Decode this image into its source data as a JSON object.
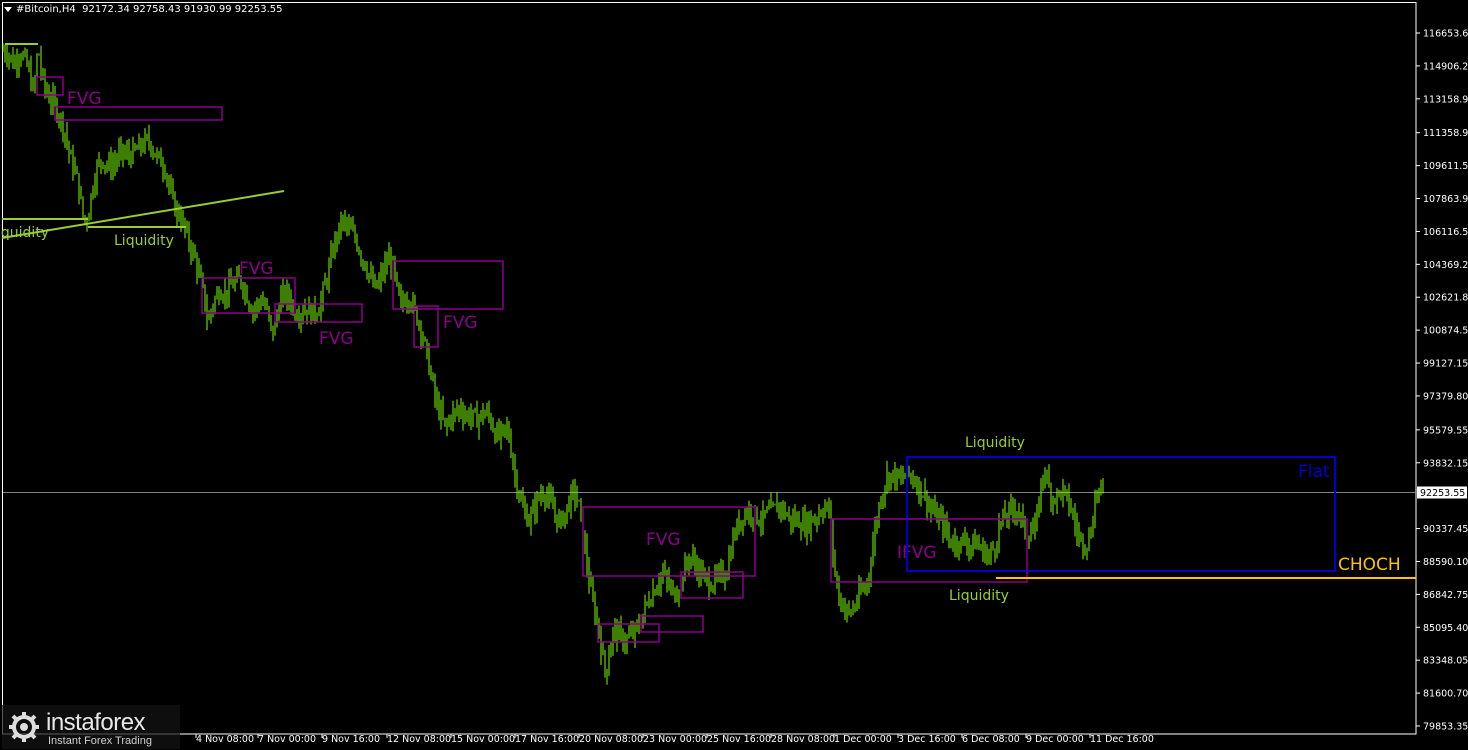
{
  "header": {
    "symbol": "#Bitcoin,H4",
    "ohlc": "92172.34 92758.43 91930.99 92253.55"
  },
  "branding": {
    "name": "instaforex",
    "tagline": "Instant Forex Trading",
    "icon": "instaforex-gear-icon"
  },
  "colors": {
    "background": "#000000",
    "candle": "#7CFC00",
    "fvg": "#8B008B",
    "liquidity": "#9ACD32",
    "flat": "#0000CD",
    "choch": "#FFC400",
    "grid_text": "#FFFFFF"
  },
  "chart_data": {
    "type": "candlestick",
    "symbol": "#Bitcoin",
    "timeframe": "H4",
    "last_price": "92253.55",
    "ylim": [
      79853.35,
      118000
    ],
    "price_ticks": [
      "116653.60",
      "114906.25",
      "113158.90",
      "111358.90",
      "109611.55",
      "107863.90",
      "106116.55",
      "104369.20",
      "102621.85",
      "100874.50",
      "99127.15",
      "97379.80",
      "95579.55",
      "93832.15",
      "92253.55",
      "90337.45",
      "88590.10",
      "86842.75",
      "85095.40",
      "83348.05",
      "81600.70",
      "79853.35"
    ],
    "time_labels": [
      "4 Nov 08:00",
      "7 Nov 00:00",
      "9 Nov 16:00",
      "12 Nov 08:00",
      "15 Nov 00:00",
      "17 Nov 16:00",
      "20 Nov 08:00",
      "23 Nov 00:00",
      "25 Nov 16:00",
      "28 Nov 08:00",
      "1 Dec 00:00",
      "3 Dec 16:00",
      "6 Dec 08:00",
      "9 Dec 00:00",
      "11 Dec 16:00"
    ],
    "close_path": [
      [
        0,
        115800
      ],
      [
        8,
        115600
      ],
      [
        14,
        115000
      ],
      [
        20,
        115700
      ],
      [
        28,
        114800
      ],
      [
        34,
        113400
      ],
      [
        38,
        116000
      ],
      [
        42,
        114200
      ],
      [
        48,
        113300
      ],
      [
        54,
        112900
      ],
      [
        60,
        112200
      ],
      [
        66,
        111200
      ],
      [
        70,
        110000
      ],
      [
        76,
        109200
      ],
      [
        80,
        108000
      ],
      [
        84,
        106600
      ],
      [
        88,
        107000
      ],
      [
        92,
        108300
      ],
      [
        96,
        109400
      ],
      [
        102,
        110000
      ],
      [
        108,
        109600
      ],
      [
        114,
        109700
      ],
      [
        120,
        110300
      ],
      [
        126,
        110200
      ],
      [
        132,
        110200
      ],
      [
        138,
        110500
      ],
      [
        144,
        110800
      ],
      [
        150,
        110900
      ],
      [
        156,
        110100
      ],
      [
        160,
        109900
      ],
      [
        166,
        109400
      ],
      [
        170,
        108200
      ],
      [
        176,
        107200
      ],
      [
        180,
        107000
      ],
      [
        186,
        106000
      ],
      [
        190,
        105400
      ],
      [
        196,
        104500
      ],
      [
        200,
        103600
      ],
      [
        204,
        102700
      ],
      [
        208,
        101200
      ],
      [
        212,
        102200
      ],
      [
        216,
        102600
      ],
      [
        220,
        103100
      ],
      [
        226,
        102800
      ],
      [
        230,
        103200
      ],
      [
        236,
        103400
      ],
      [
        240,
        103600
      ],
      [
        246,
        102900
      ],
      [
        250,
        102200
      ],
      [
        254,
        102000
      ],
      [
        258,
        102300
      ],
      [
        262,
        102500
      ],
      [
        268,
        101700
      ],
      [
        272,
        100600
      ],
      [
        276,
        101400
      ],
      [
        280,
        102500
      ],
      [
        286,
        102800
      ],
      [
        292,
        102300
      ],
      [
        296,
        101900
      ],
      [
        300,
        101800
      ],
      [
        306,
        102100
      ],
      [
        310,
        101800
      ],
      [
        316,
        101900
      ],
      [
        320,
        102200
      ],
      [
        326,
        103500
      ],
      [
        330,
        104300
      ],
      [
        334,
        105500
      ],
      [
        338,
        106000
      ],
      [
        342,
        106700
      ],
      [
        348,
        106300
      ],
      [
        352,
        106000
      ],
      [
        356,
        105700
      ],
      [
        360,
        105000
      ],
      [
        366,
        104300
      ],
      [
        370,
        103700
      ],
      [
        374,
        103100
      ],
      [
        378,
        103200
      ],
      [
        382,
        103900
      ],
      [
        386,
        104300
      ],
      [
        390,
        104800
      ],
      [
        394,
        104000
      ],
      [
        398,
        102600
      ],
      [
        402,
        102200
      ],
      [
        406,
        102700
      ],
      [
        410,
        102600
      ],
      [
        416,
        101700
      ],
      [
        420,
        101200
      ],
      [
        424,
        100300
      ],
      [
        428,
        99200
      ],
      [
        432,
        98200
      ],
      [
        436,
        97000
      ],
      [
        440,
        96500
      ],
      [
        446,
        95600
      ],
      [
        450,
        96300
      ],
      [
        456,
        96500
      ],
      [
        460,
        96800
      ],
      [
        466,
        96300
      ],
      [
        470,
        96400
      ],
      [
        476,
        96100
      ],
      [
        480,
        96300
      ],
      [
        486,
        96500
      ],
      [
        490,
        96200
      ],
      [
        496,
        95300
      ],
      [
        500,
        95200
      ],
      [
        506,
        95700
      ],
      [
        510,
        95000
      ],
      [
        514,
        93400
      ],
      [
        518,
        92500
      ],
      [
        522,
        91500
      ],
      [
        526,
        91000
      ],
      [
        530,
        90800
      ],
      [
        534,
        91400
      ],
      [
        538,
        91900
      ],
      [
        544,
        92400
      ],
      [
        548,
        91900
      ],
      [
        552,
        91500
      ],
      [
        556,
        91000
      ],
      [
        560,
        90600
      ],
      [
        566,
        91300
      ],
      [
        570,
        91900
      ],
      [
        574,
        92300
      ],
      [
        578,
        91800
      ],
      [
        582,
        90500
      ],
      [
        586,
        88800
      ],
      [
        590,
        87200
      ],
      [
        594,
        86100
      ],
      [
        598,
        85300
      ],
      [
        602,
        83700
      ],
      [
        606,
        82600
      ],
      [
        610,
        84100
      ],
      [
        614,
        85000
      ],
      [
        618,
        84700
      ],
      [
        622,
        84500
      ],
      [
        626,
        84400
      ],
      [
        630,
        84600
      ],
      [
        636,
        84900
      ],
      [
        640,
        85300
      ],
      [
        644,
        86000
      ],
      [
        650,
        86700
      ],
      [
        656,
        87300
      ],
      [
        662,
        88000
      ],
      [
        668,
        87400
      ],
      [
        674,
        86800
      ],
      [
        678,
        87200
      ],
      [
        682,
        87700
      ],
      [
        686,
        88400
      ],
      [
        690,
        88900
      ],
      [
        694,
        88500
      ],
      [
        698,
        88200
      ],
      [
        704,
        87700
      ],
      [
        708,
        87500
      ],
      [
        714,
        87500
      ],
      [
        720,
        87800
      ],
      [
        726,
        88000
      ],
      [
        730,
        89000
      ],
      [
        734,
        90000
      ],
      [
        738,
        90500
      ],
      [
        742,
        91000
      ],
      [
        746,
        91200
      ],
      [
        750,
        91300
      ],
      [
        756,
        91000
      ],
      [
        762,
        90800
      ],
      [
        766,
        91100
      ],
      [
        770,
        91200
      ],
      [
        776,
        91400
      ],
      [
        780,
        91600
      ],
      [
        786,
        91100
      ],
      [
        790,
        90800
      ],
      [
        796,
        90800
      ],
      [
        800,
        90700
      ],
      [
        806,
        90500
      ],
      [
        810,
        90800
      ],
      [
        816,
        90900
      ],
      [
        820,
        91300
      ],
      [
        826,
        91500
      ],
      [
        830,
        91100
      ],
      [
        834,
        88400
      ],
      [
        838,
        86900
      ],
      [
        842,
        86400
      ],
      [
        846,
        86000
      ],
      [
        850,
        85800
      ],
      [
        856,
        86400
      ],
      [
        860,
        86900
      ],
      [
        866,
        87200
      ],
      [
        870,
        88400
      ],
      [
        874,
        89900
      ],
      [
        878,
        91300
      ],
      [
        882,
        92200
      ],
      [
        886,
        93000
      ],
      [
        890,
        93200
      ],
      [
        896,
        93100
      ],
      [
        900,
        92900
      ],
      [
        906,
        93100
      ],
      [
        910,
        93200
      ],
      [
        916,
        92800
      ],
      [
        920,
        92500
      ],
      [
        926,
        92000
      ],
      [
        930,
        91400
      ],
      [
        936,
        91000
      ],
      [
        940,
        90800
      ],
      [
        946,
        90300
      ],
      [
        950,
        89600
      ],
      [
        956,
        89700
      ],
      [
        960,
        89600
      ],
      [
        966,
        89700
      ],
      [
        970,
        89400
      ],
      [
        976,
        89600
      ],
      [
        980,
        89300
      ],
      [
        986,
        89000
      ],
      [
        990,
        88900
      ],
      [
        996,
        89600
      ],
      [
        1000,
        90600
      ],
      [
        1006,
        91000
      ],
      [
        1010,
        91200
      ],
      [
        1016,
        91500
      ],
      [
        1020,
        91000
      ],
      [
        1026,
        90100
      ],
      [
        1030,
        90100
      ],
      [
        1036,
        90400
      ],
      [
        1040,
        92200
      ],
      [
        1044,
        93700
      ],
      [
        1048,
        92600
      ],
      [
        1052,
        92000
      ],
      [
        1058,
        92100
      ],
      [
        1062,
        92400
      ],
      [
        1066,
        91900
      ],
      [
        1070,
        91600
      ],
      [
        1076,
        90300
      ],
      [
        1080,
        89800
      ],
      [
        1086,
        89600
      ],
      [
        1090,
        89800
      ],
      [
        1096,
        92300
      ],
      [
        1100,
        92300
      ],
      [
        1104,
        92250
      ]
    ],
    "annotations": [
      {
        "type": "fvg_box",
        "label": "FVG"
      },
      {
        "type": "liquidity_line",
        "label": "Liquidity"
      },
      {
        "type": "flat_range",
        "label": "Flat"
      },
      {
        "type": "choch_level",
        "label": "CHOCH"
      },
      {
        "type": "ifvg_box",
        "label": "IFVG"
      }
    ],
    "labels": {
      "fvg": "FVG",
      "ifvg": "IFVG",
      "liquidity": "Liquidity",
      "liquidity_cut": "iquidity",
      "flat": "Flat",
      "choch": "CHOCH"
    },
    "grid": false,
    "legend": "none"
  }
}
